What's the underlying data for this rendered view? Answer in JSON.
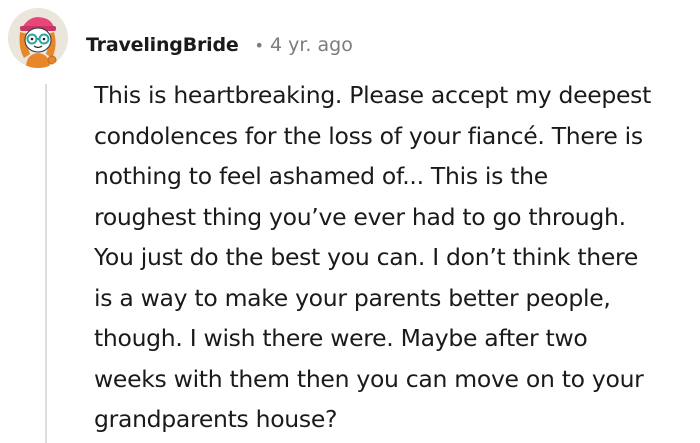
{
  "comment": {
    "avatar_icon": "snoo-avatar-icon",
    "author": "TravelingBride",
    "separator": "•",
    "timestamp": "4 yr. ago",
    "body": "This is heartbreaking. Please accept my deepest\ncondolences for the loss of your fiancé. There is\nnothing to feel ashamed of... This is the\nroughest thing you’ve ever had to go through.\nYou just do the best you can. I don’t think there\nis a way to make your parents better people,\nthough. I wish there were. Maybe after two\nweeks with them then you can move on to your\ngrandparents house?"
  },
  "colors": {
    "text": "#1a1a1b",
    "meta": "#7c7c7c",
    "thread_line": "#dcdcdc",
    "avatar_bg": "#e9e3d8"
  }
}
